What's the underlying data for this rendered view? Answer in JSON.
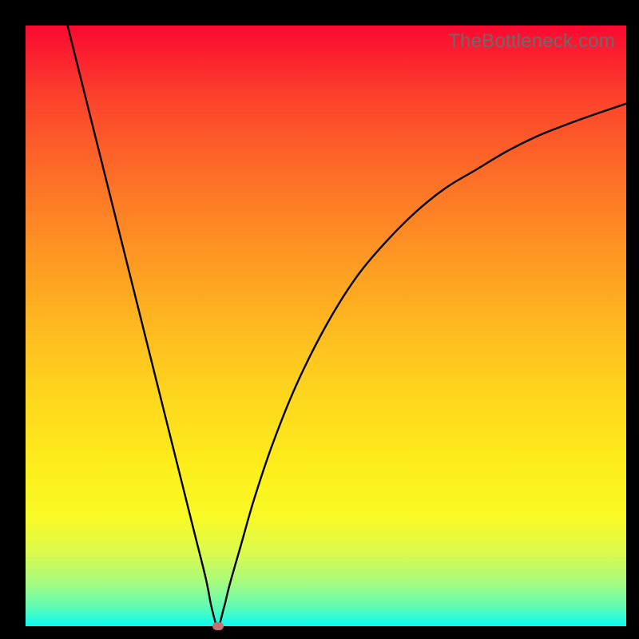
{
  "attribution": "TheBottleneck.com",
  "colors": {
    "frame": "#000000",
    "curve": "#000000",
    "minpoint": "#c77071",
    "gradient_top": "#fb0931",
    "gradient_bottom": "#04fcf4"
  },
  "chart_data": {
    "type": "line",
    "title": "",
    "xlabel": "",
    "ylabel": "",
    "xlim": [
      0,
      100
    ],
    "ylim": [
      0,
      100
    ],
    "min_point": {
      "x": 32,
      "y": 0
    },
    "series": [
      {
        "name": "bottleneck-curve",
        "x": [
          7,
          10,
          13,
          16,
          19,
          22,
          25,
          28,
          30,
          31,
          32,
          33,
          34,
          36,
          38,
          41,
          45,
          50,
          55,
          60,
          65,
          70,
          75,
          80,
          85,
          90,
          95,
          100
        ],
        "values": [
          100,
          88,
          76,
          64,
          52,
          40,
          28,
          16,
          8,
          3,
          0,
          3,
          7,
          14,
          21,
          30,
          40,
          50,
          58,
          64,
          69,
          73,
          76,
          79,
          81.5,
          83.5,
          85.3,
          87
        ]
      }
    ],
    "annotations": []
  }
}
